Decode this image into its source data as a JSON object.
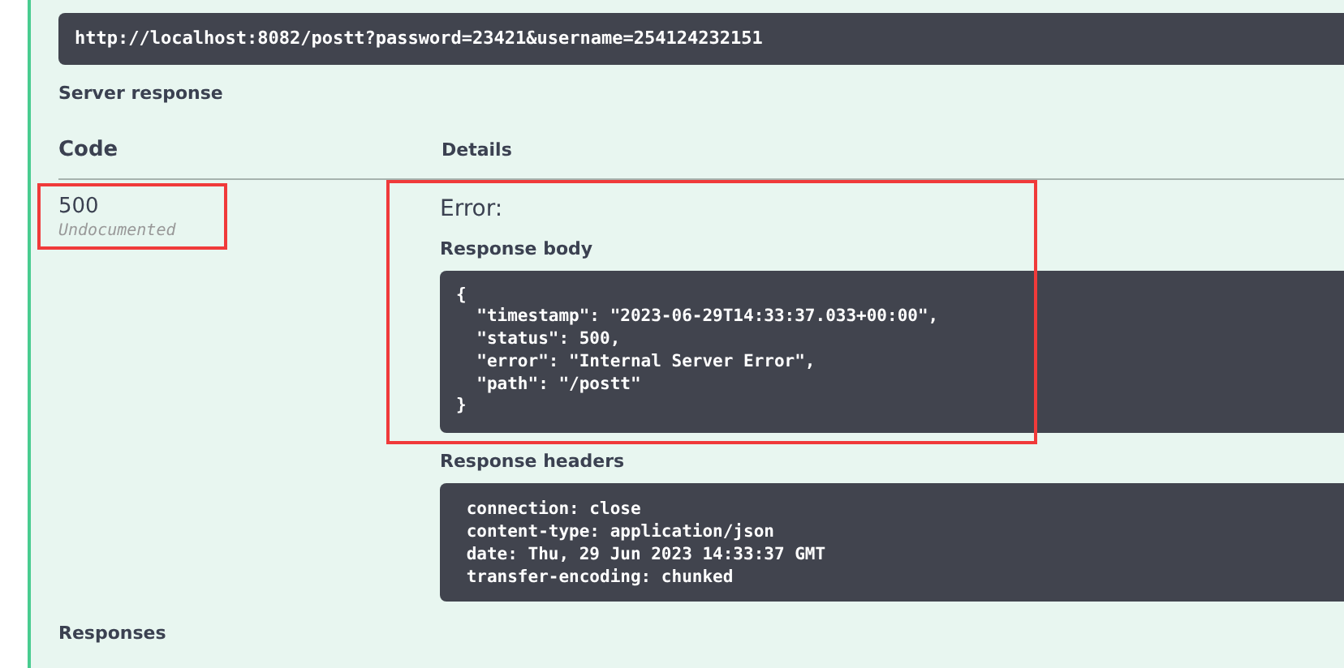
{
  "request_url": "http://localhost:8082/postt?password=23421&username=254124232151",
  "server_response": {
    "title": "Server response",
    "columns": [
      "Code",
      "Details"
    ],
    "row": {
      "code": "500",
      "code_note": "Undocumented",
      "error_title": "Error:",
      "body_label": "Response body",
      "body_lines": [
        "{",
        "  \"timestamp\": \"2023-06-29T14:33:37.033+00:00\",",
        "  \"status\": 500,",
        "  \"error\": \"Internal Server Error\",",
        "  \"path\": \"/postt\"",
        "}"
      ],
      "headers_label": "Response headers",
      "header_lines": [
        " connection: close ",
        " content-type: application/json ",
        " date: Thu, 29 Jun 2023 14:33:37 GMT ",
        " transfer-encoding: chunked "
      ]
    }
  },
  "responses_title": "Responses"
}
